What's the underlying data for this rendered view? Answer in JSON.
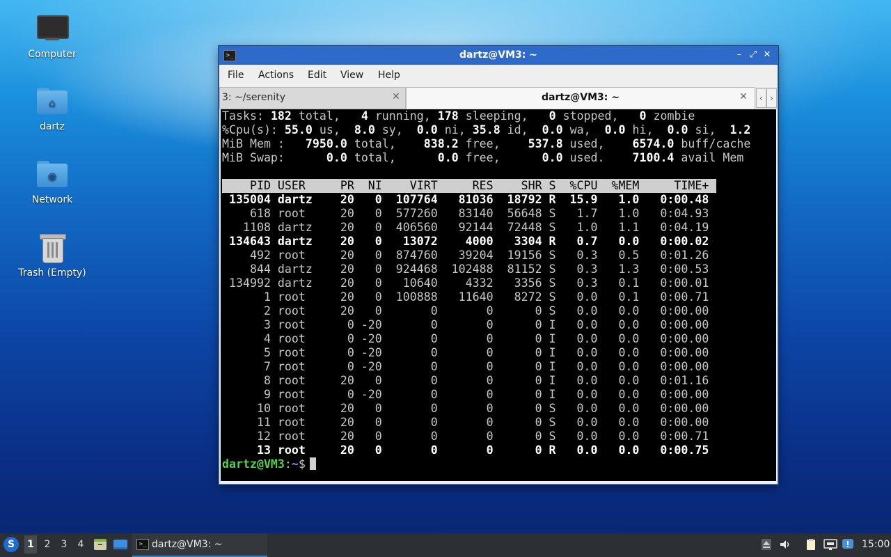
{
  "desktop": {
    "icons": [
      {
        "label": "Computer",
        "icon": "computer-icon"
      },
      {
        "label": "dartz",
        "icon": "home-folder-icon"
      },
      {
        "label": "Network",
        "icon": "network-folder-icon"
      },
      {
        "label": "Trash (Empty)",
        "icon": "trash-icon"
      }
    ]
  },
  "window": {
    "title": "dartz@VM3: ~",
    "menu": [
      "File",
      "Actions",
      "Edit",
      "View",
      "Help"
    ],
    "tabs": [
      {
        "label": "3: ~/serenity",
        "active": false
      },
      {
        "label": "dartz@VM3: ~",
        "active": true
      }
    ]
  },
  "top": {
    "summary": {
      "tasks": {
        "label": "Tasks:",
        "total": "182",
        "running": "4",
        "sleeping": "178",
        "stopped": "0",
        "zombie": "0"
      },
      "cpu": {
        "label": "%Cpu(s):",
        "us": "55.0",
        "sy": "8.0",
        "ni": "0.0",
        "id": "35.8",
        "wa": "0.0",
        "hi": "0.0",
        "si": "0.0",
        "st": "1.2"
      },
      "mem": {
        "label": "MiB Mem :",
        "total": "7950.0",
        "free": "838.2",
        "used": "537.8",
        "buff_cache": "6574.0"
      },
      "swap": {
        "label": "MiB Swap:",
        "total": "0.0",
        "free": "0.0",
        "used": "0.0",
        "avail_mem": "7100.4"
      }
    },
    "columns": [
      "PID",
      "USER",
      "PR",
      "NI",
      "VIRT",
      "RES",
      "SHR",
      "S",
      "%CPU",
      "%MEM",
      "TIME+"
    ],
    "processes": [
      {
        "pid": "135004",
        "user": "dartz",
        "pr": "20",
        "ni": "0",
        "virt": "107764",
        "res": "81036",
        "shr": "18792",
        "s": "R",
        "cpu": "15.9",
        "mem": "1.0",
        "time": "0:00.48",
        "bold": true
      },
      {
        "pid": "618",
        "user": "root",
        "pr": "20",
        "ni": "0",
        "virt": "577260",
        "res": "83140",
        "shr": "56648",
        "s": "S",
        "cpu": "1.7",
        "mem": "1.0",
        "time": "0:04.93",
        "bold": false
      },
      {
        "pid": "1108",
        "user": "dartz",
        "pr": "20",
        "ni": "0",
        "virt": "406560",
        "res": "92144",
        "shr": "72448",
        "s": "S",
        "cpu": "1.0",
        "mem": "1.1",
        "time": "0:04.19",
        "bold": false
      },
      {
        "pid": "134643",
        "user": "dartz",
        "pr": "20",
        "ni": "0",
        "virt": "13072",
        "res": "4000",
        "shr": "3304",
        "s": "R",
        "cpu": "0.7",
        "mem": "0.0",
        "time": "0:00.02",
        "bold": true
      },
      {
        "pid": "492",
        "user": "root",
        "pr": "20",
        "ni": "0",
        "virt": "874760",
        "res": "39204",
        "shr": "19156",
        "s": "S",
        "cpu": "0.3",
        "mem": "0.5",
        "time": "0:01.26",
        "bold": false
      },
      {
        "pid": "844",
        "user": "dartz",
        "pr": "20",
        "ni": "0",
        "virt": "924468",
        "res": "102488",
        "shr": "81152",
        "s": "S",
        "cpu": "0.3",
        "mem": "1.3",
        "time": "0:00.53",
        "bold": false
      },
      {
        "pid": "134992",
        "user": "dartz",
        "pr": "20",
        "ni": "0",
        "virt": "10640",
        "res": "4332",
        "shr": "3356",
        "s": "S",
        "cpu": "0.3",
        "mem": "0.1",
        "time": "0:00.01",
        "bold": false
      },
      {
        "pid": "1",
        "user": "root",
        "pr": "20",
        "ni": "0",
        "virt": "100888",
        "res": "11640",
        "shr": "8272",
        "s": "S",
        "cpu": "0.0",
        "mem": "0.1",
        "time": "0:00.71",
        "bold": false
      },
      {
        "pid": "2",
        "user": "root",
        "pr": "20",
        "ni": "0",
        "virt": "0",
        "res": "0",
        "shr": "0",
        "s": "S",
        "cpu": "0.0",
        "mem": "0.0",
        "time": "0:00.00",
        "bold": false
      },
      {
        "pid": "3",
        "user": "root",
        "pr": "0",
        "ni": "-20",
        "virt": "0",
        "res": "0",
        "shr": "0",
        "s": "I",
        "cpu": "0.0",
        "mem": "0.0",
        "time": "0:00.00",
        "bold": false
      },
      {
        "pid": "4",
        "user": "root",
        "pr": "0",
        "ni": "-20",
        "virt": "0",
        "res": "0",
        "shr": "0",
        "s": "I",
        "cpu": "0.0",
        "mem": "0.0",
        "time": "0:00.00",
        "bold": false
      },
      {
        "pid": "5",
        "user": "root",
        "pr": "0",
        "ni": "-20",
        "virt": "0",
        "res": "0",
        "shr": "0",
        "s": "I",
        "cpu": "0.0",
        "mem": "0.0",
        "time": "0:00.00",
        "bold": false
      },
      {
        "pid": "7",
        "user": "root",
        "pr": "0",
        "ni": "-20",
        "virt": "0",
        "res": "0",
        "shr": "0",
        "s": "I",
        "cpu": "0.0",
        "mem": "0.0",
        "time": "0:00.00",
        "bold": false
      },
      {
        "pid": "8",
        "user": "root",
        "pr": "20",
        "ni": "0",
        "virt": "0",
        "res": "0",
        "shr": "0",
        "s": "I",
        "cpu": "0.0",
        "mem": "0.0",
        "time": "0:01.16",
        "bold": false
      },
      {
        "pid": "9",
        "user": "root",
        "pr": "0",
        "ni": "-20",
        "virt": "0",
        "res": "0",
        "shr": "0",
        "s": "I",
        "cpu": "0.0",
        "mem": "0.0",
        "time": "0:00.00",
        "bold": false
      },
      {
        "pid": "10",
        "user": "root",
        "pr": "20",
        "ni": "0",
        "virt": "0",
        "res": "0",
        "shr": "0",
        "s": "S",
        "cpu": "0.0",
        "mem": "0.0",
        "time": "0:00.00",
        "bold": false
      },
      {
        "pid": "11",
        "user": "root",
        "pr": "20",
        "ni": "0",
        "virt": "0",
        "res": "0",
        "shr": "0",
        "s": "S",
        "cpu": "0.0",
        "mem": "0.0",
        "time": "0:00.00",
        "bold": false
      },
      {
        "pid": "12",
        "user": "root",
        "pr": "20",
        "ni": "0",
        "virt": "0",
        "res": "0",
        "shr": "0",
        "s": "S",
        "cpu": "0.0",
        "mem": "0.0",
        "time": "0:00.71",
        "bold": false
      },
      {
        "pid": "13",
        "user": "root",
        "pr": "20",
        "ni": "0",
        "virt": "0",
        "res": "0",
        "shr": "0",
        "s": "R",
        "cpu": "0.0",
        "mem": "0.0",
        "time": "0:00.75",
        "bold": true
      }
    ],
    "prompt": {
      "user_host": "dartz@VM3",
      "path": "~",
      "symbol": "$"
    }
  },
  "taskbar": {
    "workspaces": [
      "1",
      "2",
      "3",
      "4"
    ],
    "current_workspace": "1",
    "task_label": "dartz@VM3: ~",
    "clock": "15:00"
  },
  "colors": {
    "titlebar": "#2e6ac8",
    "terminal_bg": "#000000",
    "prompt_user": "#52d04a",
    "prompt_path": "#5fa2ff",
    "taskbar_bg": "#2c2f33"
  }
}
